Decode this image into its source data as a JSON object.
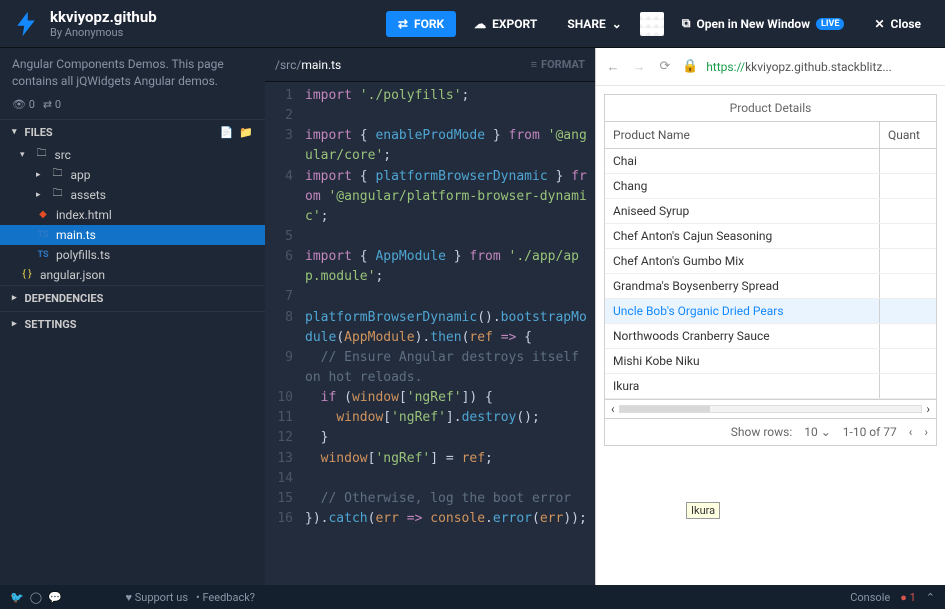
{
  "header": {
    "title": "kkviyopz.github",
    "byline": "By Anonymous",
    "fork": "FORK",
    "export": "EXPORT",
    "share": "SHARE",
    "open_new": "Open in New Window",
    "live": "LIVE",
    "close": "Close"
  },
  "sidebar": {
    "description": "Angular Components Demos. This page contains all jQWidgets Angular demos.",
    "views": "0",
    "forks": "0",
    "files_header": "FILES",
    "deps_header": "DEPENDENCIES",
    "settings_header": "SETTINGS",
    "tree": {
      "src": "src",
      "app": "app",
      "assets": "assets",
      "index": "index.html",
      "main": "main.ts",
      "polyfills": "polyfills.ts",
      "angular": "angular.json"
    }
  },
  "editor": {
    "path_dir": "/src/",
    "path_file": "main.ts",
    "format": "FORMAT"
  },
  "preview": {
    "protocol": "https://",
    "url_rest": "kkviyopz.github.stackblitz...",
    "grid_title": "Product Details",
    "col_name": "Product Name",
    "col_qty": "Quant",
    "rows": [
      "Chai",
      "Chang",
      "Aniseed Syrup",
      "Chef Anton's Cajun Seasoning",
      "Chef Anton's Gumbo Mix",
      "Grandma's Boysenberry Spread",
      "Uncle Bob's Organic Dried Pears",
      "Northwoods Cranberry Sauce",
      "Mishi Kobe Niku",
      "Ikura"
    ],
    "selected_index": 6,
    "tooltip": "Ikura",
    "pager_show": "Show rows:",
    "pager_size": "10",
    "pager_range": "1-10 of 77"
  },
  "footer": {
    "support": "Support us",
    "feedback": "Feedback?",
    "console": "Console",
    "problems": "1"
  }
}
